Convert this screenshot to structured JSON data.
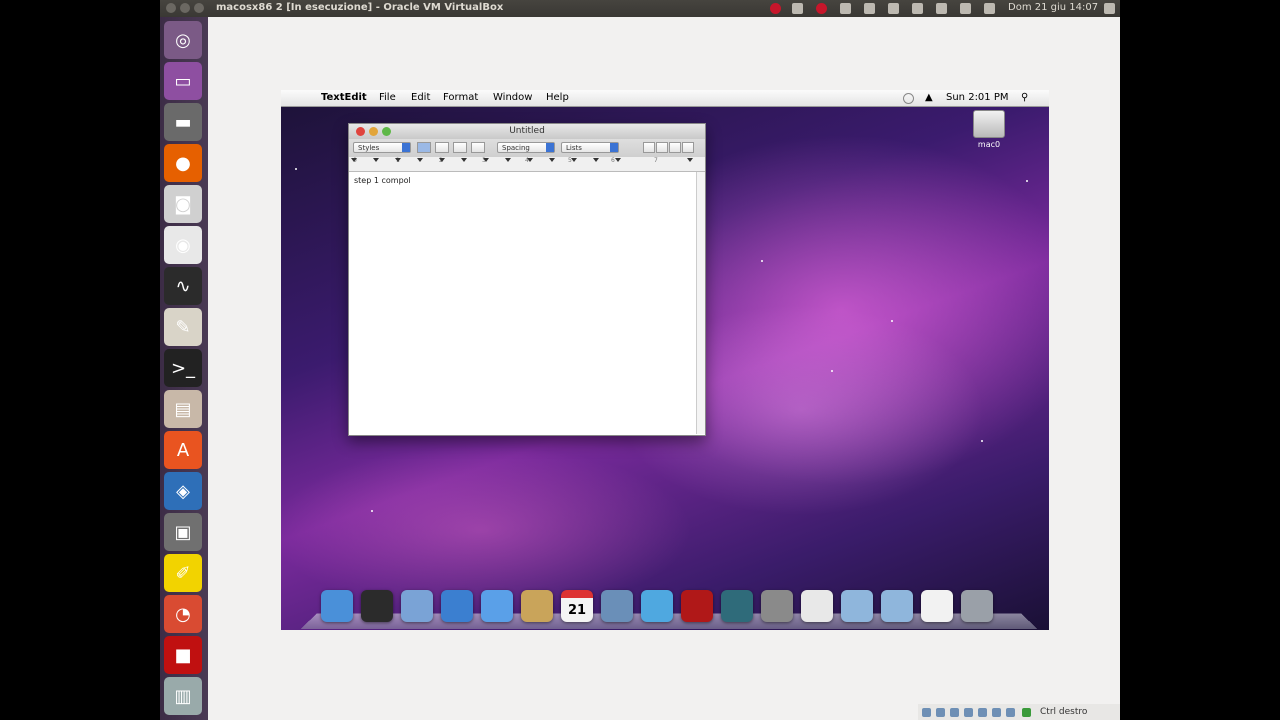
{
  "ubuntu_panel": {
    "window_title": "macosx86 2 [In esecuzione] - Oracle VM VirtualBox",
    "clock": "Dom 21 giu 14:07",
    "colors": {
      "panel_bg": "#3c3b37",
      "record_red": "#c7162b"
    }
  },
  "launcher": {
    "items": [
      {
        "name": "dash-home",
        "icon": "ubuntu-logo-icon",
        "glyph": "◎"
      },
      {
        "name": "files",
        "icon": "window-app-icon",
        "glyph": "▭"
      },
      {
        "name": "drive",
        "icon": "drive-icon",
        "glyph": "▬"
      },
      {
        "name": "firefox",
        "icon": "firefox-icon",
        "glyph": "●"
      },
      {
        "name": "camera",
        "icon": "camera-icon",
        "glyph": "◙"
      },
      {
        "name": "chat",
        "icon": "chat-icon",
        "glyph": "◉"
      },
      {
        "name": "system-monitor",
        "icon": "system-monitor-icon",
        "glyph": "∿"
      },
      {
        "name": "text-editor",
        "icon": "text-editor-icon",
        "glyph": "✎"
      },
      {
        "name": "terminal",
        "icon": "terminal-icon",
        "glyph": ">_"
      },
      {
        "name": "file-manager",
        "icon": "folder-icon",
        "glyph": "▤"
      },
      {
        "name": "software-center",
        "icon": "software-center-icon",
        "glyph": "A"
      },
      {
        "name": "virtualbox",
        "icon": "virtualbox-icon",
        "glyph": "◈"
      },
      {
        "name": "disk-utility",
        "icon": "disk-icon",
        "glyph": "▣"
      },
      {
        "name": "notes",
        "icon": "notes-icon",
        "glyph": "✐"
      },
      {
        "name": "pie-app",
        "icon": "pie-chart-icon",
        "glyph": "◔"
      },
      {
        "name": "red-app",
        "icon": "red-app-icon",
        "glyph": "■"
      },
      {
        "name": "trash",
        "icon": "trash-icon",
        "glyph": "▥"
      }
    ]
  },
  "vbox_status": {
    "host_key": "Ctrl destro"
  },
  "mac": {
    "menubar": {
      "app_name": "TextEdit",
      "menus": [
        "File",
        "Edit",
        "Format",
        "Window",
        "Help"
      ],
      "clock": "Sun 2:01 PM"
    },
    "textedit": {
      "title": "Untitled",
      "styles_select": "Styles",
      "spacing_select": "Spacing",
      "lists_select": "Lists",
      "ruler_numbers": [
        "0",
        "1",
        "2",
        "3",
        "4",
        "5",
        "6",
        "7"
      ],
      "body_text": "step 1 compol"
    },
    "desktop_disk": {
      "label": "mac0"
    },
    "dock": [
      {
        "name": "finder",
        "icon": "finder-icon",
        "color": "#4a90d9"
      },
      {
        "name": "dashboard",
        "icon": "dashboard-icon",
        "color": "#2b2b2b"
      },
      {
        "name": "mail",
        "icon": "mail-icon",
        "color": "#7aa3d6"
      },
      {
        "name": "safari",
        "icon": "safari-icon",
        "color": "#3b7fd0"
      },
      {
        "name": "ichat",
        "icon": "ichat-icon",
        "color": "#5aa0e8"
      },
      {
        "name": "address-book",
        "icon": "address-book-icon",
        "color": "#c9a45a"
      },
      {
        "name": "ical",
        "icon": "calendar-icon",
        "color": "#f4f4f4"
      },
      {
        "name": "iphoto",
        "icon": "iphoto-icon",
        "color": "#6a8fb8"
      },
      {
        "name": "itunes",
        "icon": "itunes-icon",
        "color": "#4fa8e0"
      },
      {
        "name": "photo-booth",
        "icon": "photo-booth-icon",
        "color": "#b01818"
      },
      {
        "name": "time-machine",
        "icon": "time-machine-icon",
        "color": "#2f6b7a"
      },
      {
        "name": "system-preferences",
        "icon": "gear-icon",
        "color": "#8a8a8a"
      },
      {
        "name": "preview",
        "icon": "preview-icon",
        "color": "#e8e8e8"
      },
      {
        "name": "applications-folder",
        "icon": "folder-icon",
        "color": "#8fb6dc"
      },
      {
        "name": "documents-folder",
        "icon": "folder-icon",
        "color": "#8fb6dc"
      },
      {
        "name": "downloads-stack",
        "icon": "document-icon",
        "color": "#f2f2f2"
      },
      {
        "name": "trash",
        "icon": "trash-icon",
        "color": "#9aa0a8"
      }
    ],
    "calendar_day": "21"
  }
}
